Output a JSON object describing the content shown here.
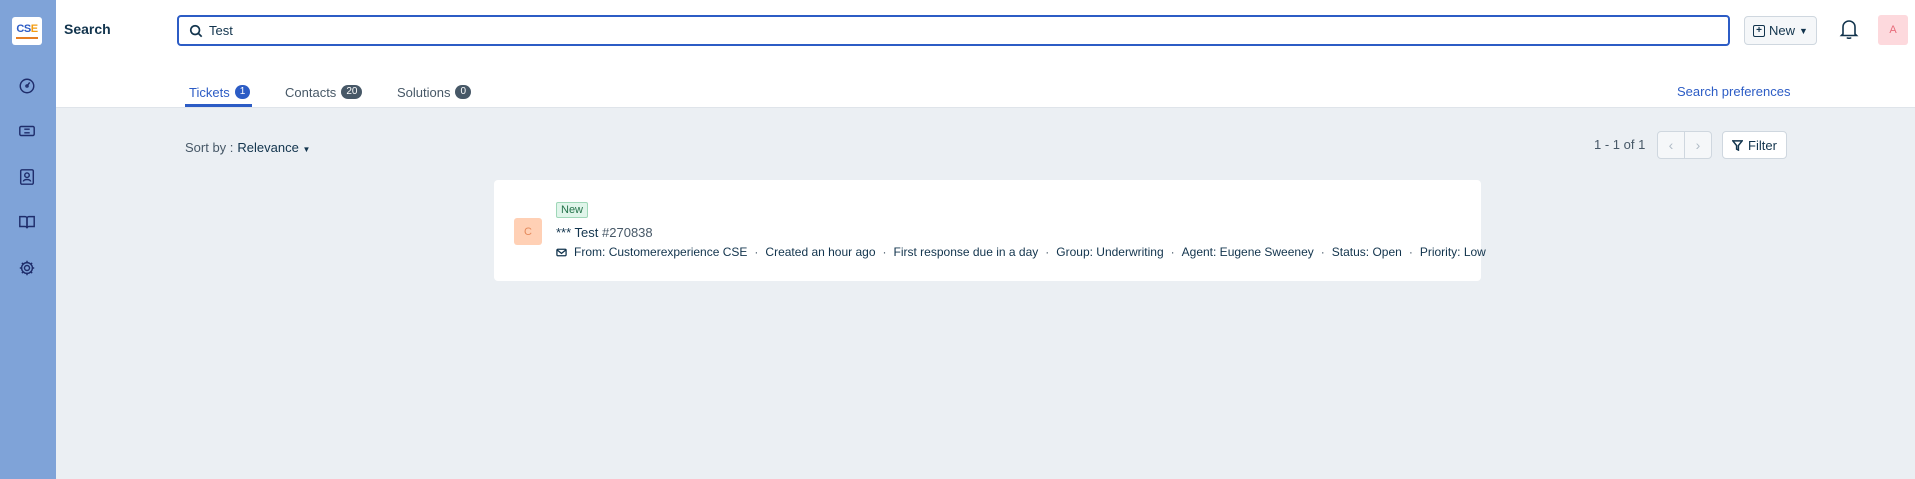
{
  "sidebar": {
    "logo_text_c": "C",
    "logo_text_s": "S",
    "logo_text_e": "E",
    "icons": [
      "dashboard-icon",
      "tickets-icon",
      "contacts-icon",
      "solutions-icon",
      "settings-icon"
    ]
  },
  "header": {
    "title": "Search",
    "search_value": "Test",
    "new_label": "New",
    "avatar_initial": "A"
  },
  "tabs": [
    {
      "label": "Tickets",
      "count": "1",
      "active": true
    },
    {
      "label": "Contacts",
      "count": "20",
      "active": false
    },
    {
      "label": "Solutions",
      "count": "0",
      "active": false
    }
  ],
  "search_preferences": "Search preferences",
  "toolbar": {
    "sort_label": "Sort by :",
    "sort_value": "Relevance",
    "pagination": "1 - 1 of 1",
    "filter_label": "Filter"
  },
  "results": [
    {
      "avatar": "C",
      "status": "New",
      "title": "*** Test",
      "ticket_id": "#270838",
      "from_label": "From:",
      "from": "Customerexperience CSE",
      "created": "Created an hour ago",
      "first_response": "First response due in a day",
      "group": "Group: Underwriting",
      "agent": "Agent: Eugene Sweeney",
      "status_text": "Status: Open",
      "priority": "Priority: Low"
    }
  ],
  "colors": {
    "sidebar": "#7fa3d8",
    "accent": "#2c5cc5",
    "background": "#ebeff3"
  }
}
